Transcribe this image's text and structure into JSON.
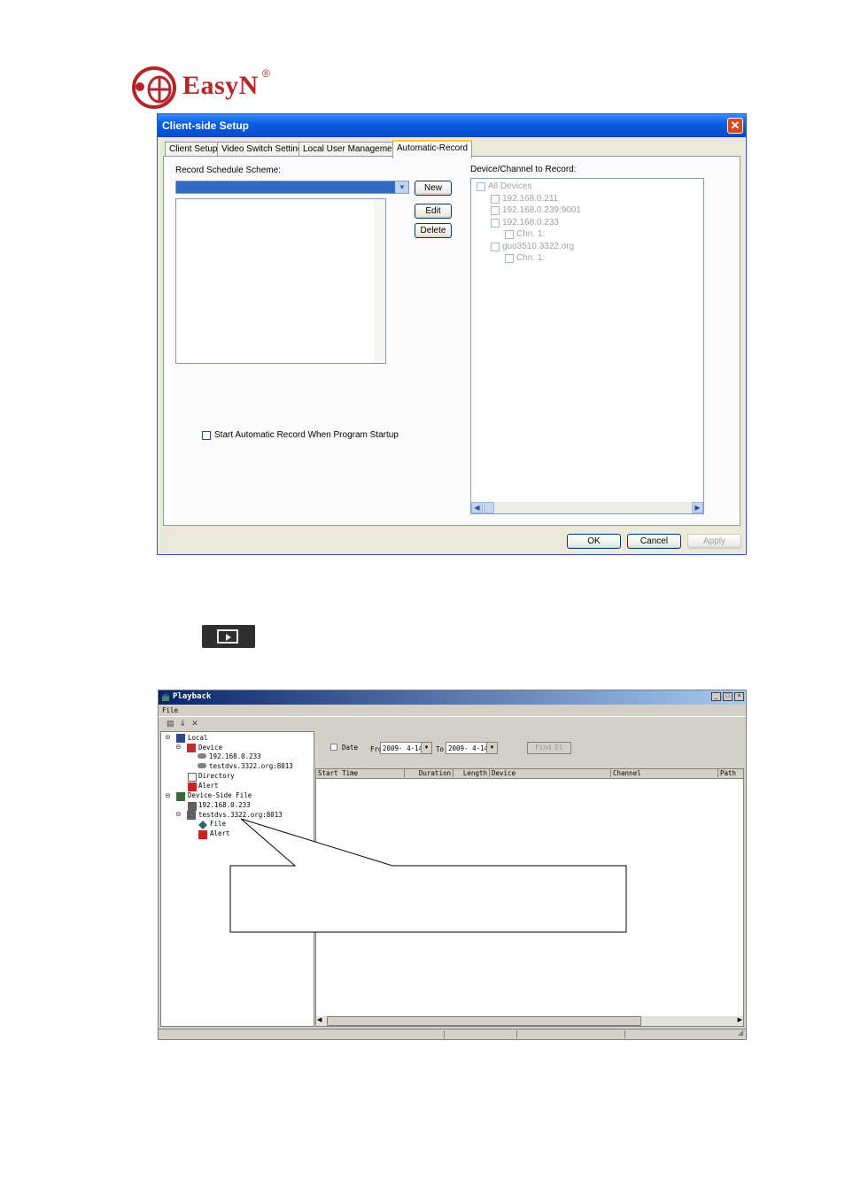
{
  "logo": {
    "brand": "EasyN",
    "reg": "®"
  },
  "dialog1": {
    "title": "Client-side Setup",
    "close": "✕",
    "tabs": [
      "Client Setup",
      "Video Switch Setting",
      "Local User Management",
      "Automatic-Record"
    ],
    "schedule_label": "Record Schedule Scheme:",
    "buttons": {
      "new": "New",
      "edit": "Edit",
      "delete": "Delete"
    },
    "startup_checkbox": "Start Automatic Record When Program Startup",
    "device_label": "Device/Channel to Record:",
    "tree": [
      {
        "label": "All Devices",
        "level": 0
      },
      {
        "label": "192.168.0.211",
        "level": 1
      },
      {
        "label": "192.168.0.239:9001",
        "level": 1
      },
      {
        "label": "192.168.0.233",
        "level": 1
      },
      {
        "label": "Chn. 1:",
        "level": 2
      },
      {
        "label": "guo3510.3322.org",
        "level": 1
      },
      {
        "label": "Chn. 1:",
        "level": 2
      }
    ],
    "footer": {
      "ok": "OK",
      "cancel": "Cancel",
      "apply": "Apply"
    }
  },
  "dialog2": {
    "title": "Playback",
    "menu": "File",
    "tree": {
      "local": "Local",
      "device": "Device",
      "ip1": "192.168.0.233",
      "ip2": "testdvs.3322.org:8013",
      "directory": "Directory",
      "alert": "Alert",
      "device_side": "Device-Side File",
      "ds_ip1": "192.168.0.233",
      "ds_ip2": "testdvs.3322.org:8013",
      "file": "File",
      "ds_alert": "Alert"
    },
    "date_label": "Date",
    "from_label": "Fro",
    "from_value": "2009- 4-14",
    "to_label": "To",
    "to_value": "2009- 4-14",
    "find_button": "Find El",
    "columns": [
      "Start Time",
      "Duration",
      "Length",
      "Device",
      "Channel",
      "Path"
    ]
  }
}
